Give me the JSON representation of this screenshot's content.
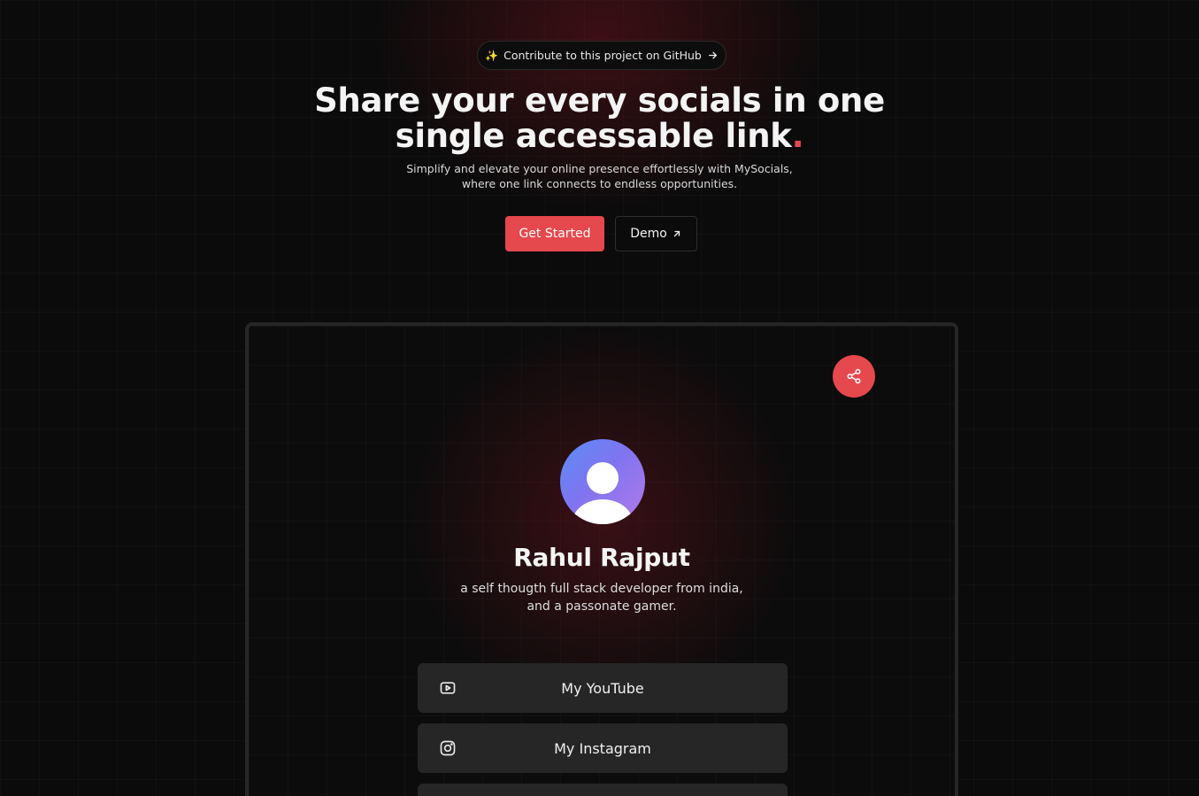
{
  "banner": {
    "sparkle": "✨",
    "text": "Contribute to this project on GitHub"
  },
  "hero": {
    "title_line1": "Share your every socials in one",
    "title_line2": "single accessable link",
    "title_dot": ".",
    "subtitle_line1": "Simplify and elevate your online presence effortlessly with MySocials,",
    "subtitle_line2": "where one link connects to endless opportunities."
  },
  "actions": {
    "get_started": "Get Started",
    "demo": "Demo"
  },
  "preview": {
    "name": "Rahul Rajput",
    "bio_line1": "a self thougth full stack developer from india,",
    "bio_line2": "and a passonate gamer.",
    "links": [
      {
        "label": "My YouTube",
        "icon": "youtube-icon"
      },
      {
        "label": "My Instagram",
        "icon": "instagram-icon"
      },
      {
        "label": "",
        "icon": ""
      }
    ]
  },
  "colors": {
    "accent": "#e5484d",
    "background": "#0b0b0b",
    "card": "#262626",
    "avatar_gradient": [
      "#5a8ef6",
      "#b27ae8"
    ]
  }
}
